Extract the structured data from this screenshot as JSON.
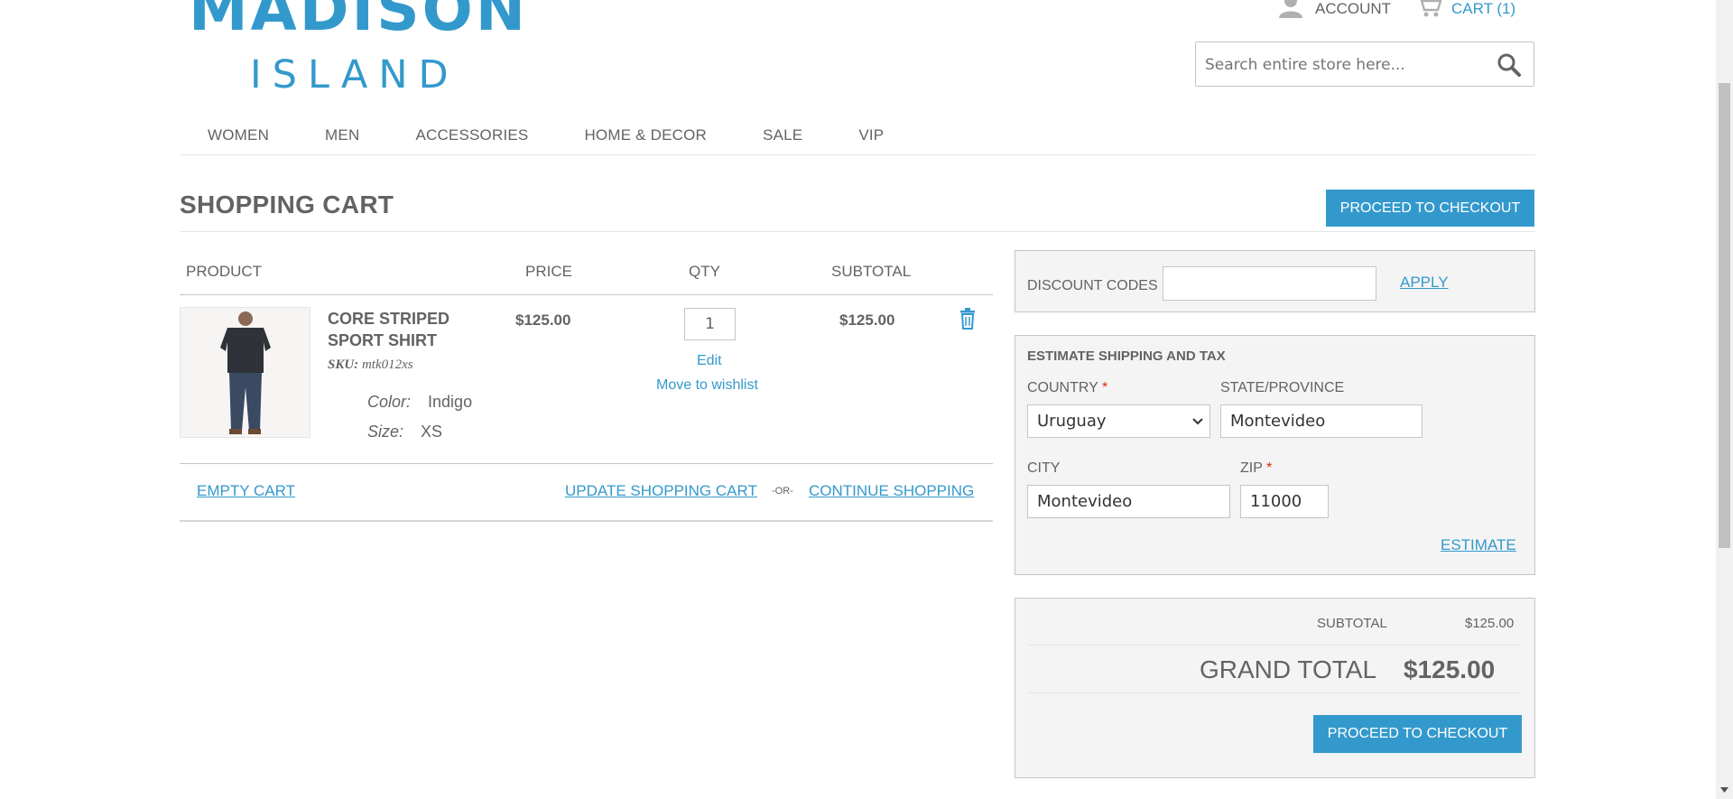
{
  "header": {
    "logo_top": "MADISON",
    "logo_bottom": "ISLAND",
    "account_label": "ACCOUNT",
    "cart_label": "CART (1)",
    "search_placeholder": "Search entire store here..."
  },
  "nav": {
    "items": [
      "WOMEN",
      "MEN",
      "ACCESSORIES",
      "HOME & DECOR",
      "SALE",
      "VIP"
    ]
  },
  "page": {
    "title": "SHOPPING CART",
    "checkout_button": "PROCEED TO CHECKOUT"
  },
  "cart": {
    "headers": {
      "product": "PRODUCT",
      "price": "PRICE",
      "qty": "QTY",
      "subtotal": "SUBTOTAL"
    },
    "item": {
      "name": "CORE STRIPED SPORT SHIRT",
      "sku_label": "SKU:",
      "sku": "mtk012xs",
      "color_label": "Color:",
      "color": "Indigo",
      "size_label": "Size:",
      "size": "XS",
      "price": "$125.00",
      "qty": "1",
      "edit_label": "Edit",
      "wishlist_label": "Move to wishlist",
      "subtotal": "$125.00"
    },
    "empty_cart": "EMPTY CART",
    "update_cart": "UPDATE SHOPPING CART",
    "or_label": "-OR-",
    "continue_shopping": "CONTINUE SHOPPING"
  },
  "discount": {
    "label": "DISCOUNT CODES",
    "value": "",
    "apply_label": "APPLY"
  },
  "shipping": {
    "title": "ESTIMATE SHIPPING AND TAX",
    "country_label": "COUNTRY",
    "country_value": "Uruguay",
    "state_label": "STATE/PROVINCE",
    "state_value": "Montevideo",
    "city_label": "CITY",
    "city_value": "Montevideo",
    "zip_label": "ZIP",
    "zip_value": "11000",
    "required_mark": "*",
    "estimate_label": "ESTIMATE"
  },
  "totals": {
    "subtotal_label": "SUBTOTAL",
    "subtotal_value": "$125.00",
    "grand_total_label": "GRAND TOTAL",
    "grand_total_value": "$125.00",
    "checkout_button": "PROCEED TO CHECKOUT"
  },
  "colors": {
    "accent": "#3399cc",
    "text": "#636363",
    "panel_bg": "#f4f4f4",
    "required": "#df280a"
  }
}
